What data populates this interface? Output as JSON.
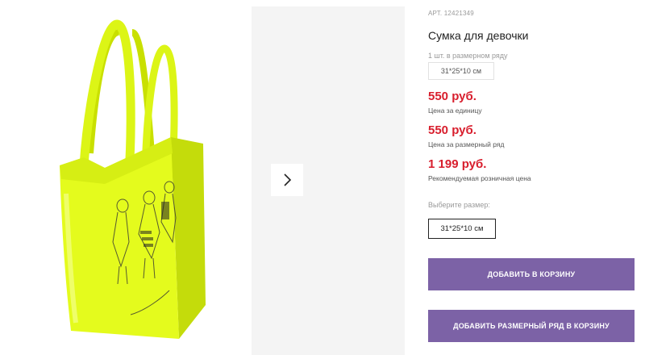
{
  "product": {
    "sku": "АРТ. 12421349",
    "title": "Сумка для девочки",
    "pack_note": "1 шт. в размерном ряду",
    "pack_size": "31*25*10 см",
    "image_alt": "Сумка для девочки"
  },
  "prices": {
    "unit_price": "550 руб.",
    "unit_label": "Цена за единицу",
    "pack_price": "550 руб.",
    "pack_label": "Цена за размерный ряд",
    "retail_price": "1 199 руб.",
    "retail_label": "Рекомендуемая розничная цена"
  },
  "size": {
    "label": "Выберите размер:",
    "selected": "31*25*10 см"
  },
  "actions": {
    "add_to_cart": "ДОБАВИТЬ В КОРЗИНУ",
    "add_pack_to_cart": "ДОБАВИТЬ РАЗМЕРНЫЙ РЯД В КОРЗИНУ"
  },
  "icons": {
    "next": "chevron-right-icon"
  },
  "colors": {
    "price": "#d81e2d",
    "button": "#7c62a6",
    "bag": "#e6ff1f"
  }
}
